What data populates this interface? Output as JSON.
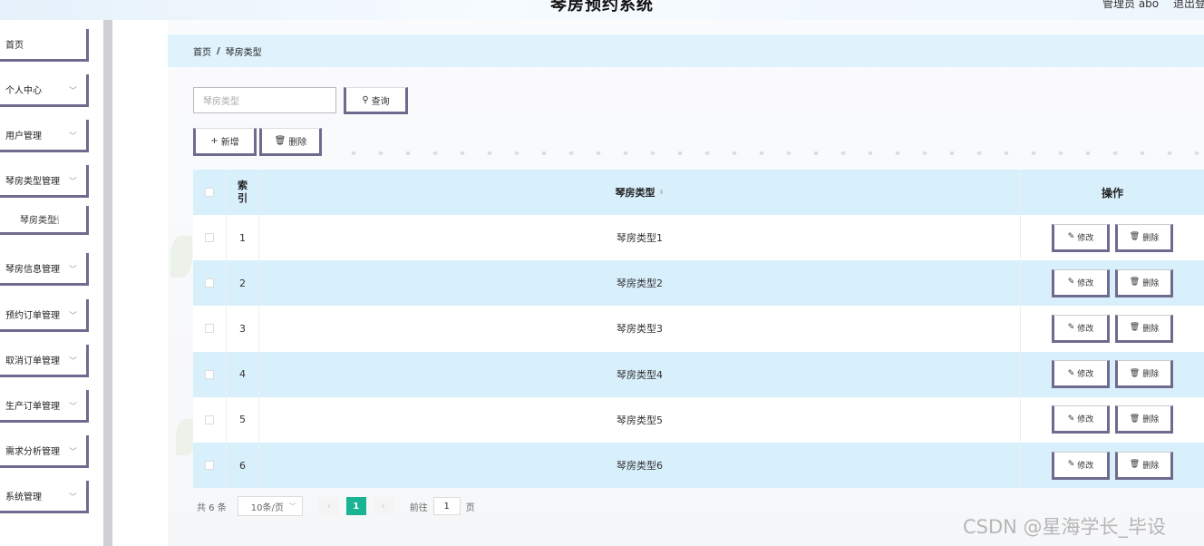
{
  "header": {
    "title": "琴房预约系统",
    "user": "管理员 abo",
    "logout": "退出登"
  },
  "sidebar": {
    "items": [
      {
        "label": "首页",
        "has_chevron": false
      },
      {
        "label": "个人中心",
        "has_chevron": true
      },
      {
        "label": "用户管理",
        "has_chevron": true
      },
      {
        "label": "琴房类型管理",
        "has_chevron": true
      },
      {
        "label": "琴房信息管理",
        "has_chevron": true
      },
      {
        "label": "预约订单管理",
        "has_chevron": true
      },
      {
        "label": "取消订单管理",
        "has_chevron": true
      },
      {
        "label": "生产订单管理",
        "has_chevron": true
      },
      {
        "label": "需求分析管理",
        "has_chevron": true
      },
      {
        "label": "系统管理",
        "has_chevron": true
      }
    ],
    "submenu": {
      "label": "琴房类型"
    }
  },
  "breadcrumb": {
    "home": "首页",
    "separator": "/",
    "current": "琴房类型"
  },
  "search": {
    "placeholder": "琴房类型",
    "button": "查询"
  },
  "toolbar": {
    "add": "新增",
    "delete": "删除"
  },
  "table": {
    "headers": {
      "index": "索引",
      "type": "琴房类型",
      "ops": "操作"
    },
    "rows": [
      {
        "index": "1",
        "type": "琴房类型1"
      },
      {
        "index": "2",
        "type": "琴房类型2"
      },
      {
        "index": "3",
        "type": "琴房类型3"
      },
      {
        "index": "4",
        "type": "琴房类型4"
      },
      {
        "index": "5",
        "type": "琴房类型5"
      },
      {
        "index": "6",
        "type": "琴房类型6"
      }
    ],
    "edit_label": "修改",
    "delete_label": "删除"
  },
  "pagination": {
    "total": "共 6 条",
    "page_size": "10条/页",
    "current": "1",
    "goto": "前往",
    "goto_value": "1",
    "page_unit": "页"
  },
  "watermark": "CSDN @星海学长_毕设",
  "colors": {
    "accent": "#1ab394",
    "header_bg": "#d8effc",
    "button_border": "#6f6b8e"
  }
}
